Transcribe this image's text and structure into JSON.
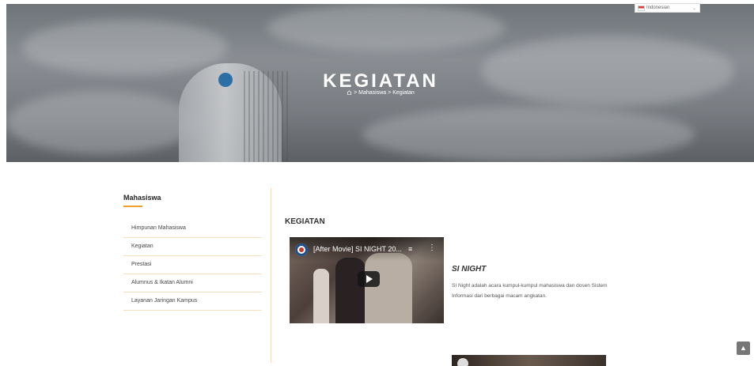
{
  "language_select": {
    "value": "Indonesian"
  },
  "hero": {
    "title": "KEGIATAN",
    "breadcrumb": [
      ">",
      "Mahasiswa",
      ">",
      "Kegiatan"
    ]
  },
  "sidebar": {
    "title": "Mahasiswa",
    "items": [
      {
        "label": "Himpunan Mahasiswa"
      },
      {
        "label": "Kegiatan"
      },
      {
        "label": "Prestasi"
      },
      {
        "label": "Alumnus & Ikatan Alumni"
      },
      {
        "label": "Layanan Jaringan Kampus"
      }
    ]
  },
  "main": {
    "heading": "KEGIATAN",
    "events": [
      {
        "video_title": "[After Movie] SI NIGHT 20...",
        "title": "SI NIGHT",
        "description": "SI Night adalah acara kumpul-kumpul mahasiswa dan dosen Sistem Informasi dari berbagai macam angkatan."
      }
    ]
  },
  "icons": {
    "home": "home-icon",
    "queue": "playlist-icon",
    "more": "more-vertical-icon",
    "play": "play-icon",
    "scroll_top": "chevron-up-icon"
  },
  "colors": {
    "accent": "#f0a030",
    "divider": "#f3dcc0"
  }
}
